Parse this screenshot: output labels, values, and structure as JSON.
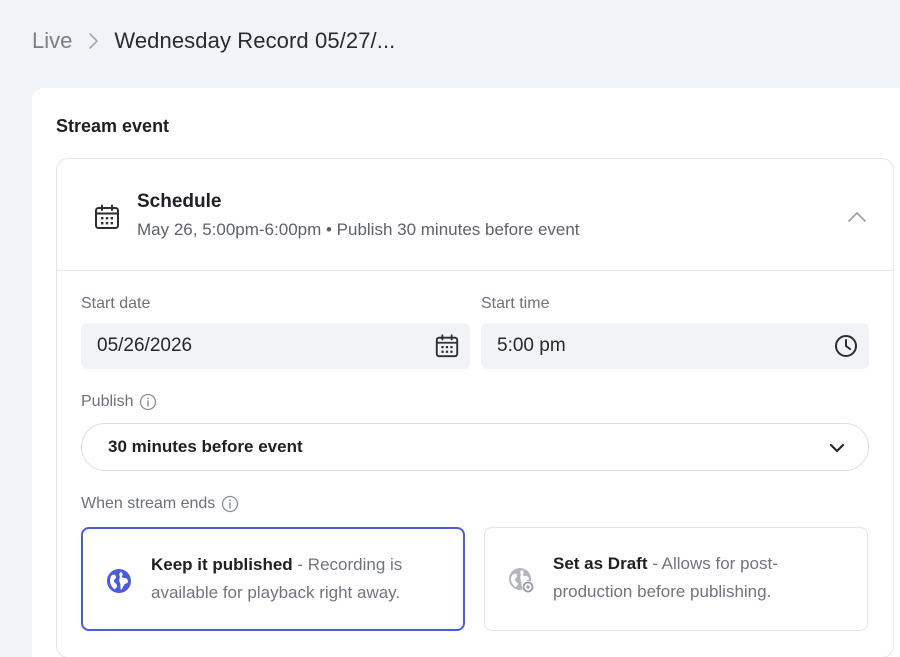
{
  "breadcrumb": {
    "root": "Live",
    "current": "Wednesday Record 05/27/..."
  },
  "section": {
    "title": "Stream event"
  },
  "schedule": {
    "title": "Schedule",
    "summary": "May 26, 5:00pm-6:00pm • Publish 30 minutes before event"
  },
  "fields": {
    "start_date_label": "Start date",
    "start_date_value": "05/26/2026",
    "start_time_label": "Start time",
    "start_time_value": "5:00 pm",
    "publish_label": "Publish",
    "publish_value": "30 minutes before event",
    "stream_ends_label": "When stream ends"
  },
  "options": [
    {
      "title": "Keep it published",
      "description": " - Recording is available for playback right away.",
      "selected": true
    },
    {
      "title": "Set as Draft",
      "description": " - Allows for post-production before publishing.",
      "selected": false
    }
  ],
  "colors": {
    "accent": "#4a5bdc",
    "page_bg": "#f0f3f7",
    "input_bg": "#f1f3f6"
  },
  "icons": {
    "breadcrumb_sep": "chevron-right-icon",
    "schedule": "calendar-icon",
    "collapse": "chevron-up-icon",
    "date": "calendar-icon",
    "time": "clock-icon",
    "info": "info-icon",
    "select": "chevron-down-icon",
    "published": "globe-icon",
    "draft": "globe-gear-icon"
  }
}
